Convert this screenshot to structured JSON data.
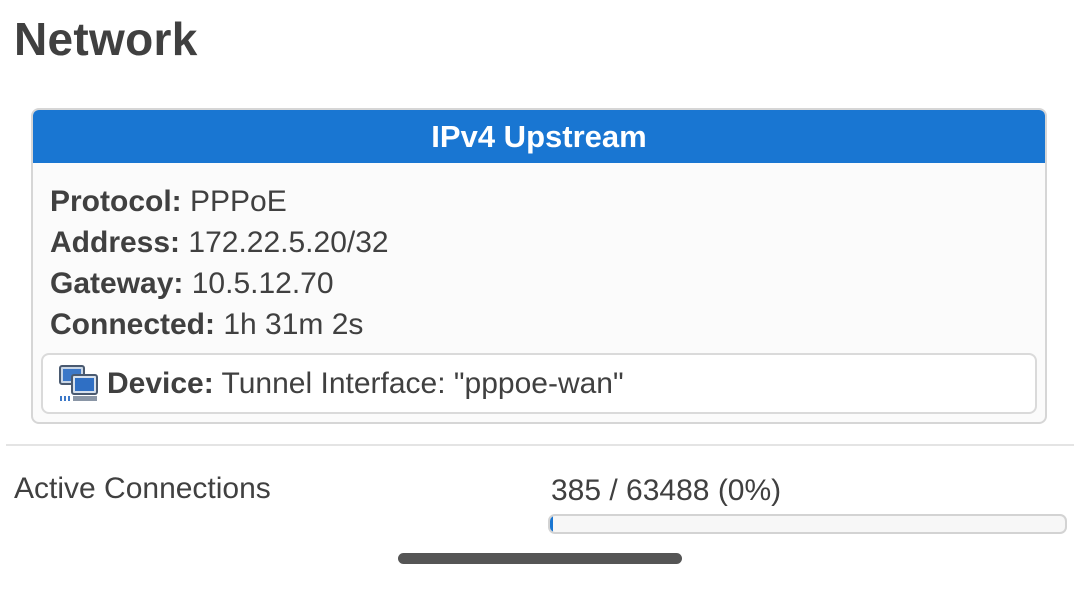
{
  "page": {
    "title": "Network"
  },
  "upstream": {
    "heading": "IPv4 Upstream",
    "rows": [
      {
        "label": "Protocol:",
        "value": "PPPoE"
      },
      {
        "label": "Address:",
        "value": "172.22.5.20/32"
      },
      {
        "label": "Gateway:",
        "value": "10.5.12.70"
      },
      {
        "label": "Connected:",
        "value": "1h 31m 2s"
      }
    ],
    "device": {
      "icon": "network-device-icon",
      "label": "Device:",
      "value": "Tunnel Interface: \"pppoe-wan\""
    }
  },
  "active_connections": {
    "label": "Active Connections",
    "value_text": "385 / 63488 (0%)",
    "current": 385,
    "max": 63488,
    "percent": 0
  },
  "colors": {
    "header_blue": "#1976d2",
    "text": "#404040"
  }
}
